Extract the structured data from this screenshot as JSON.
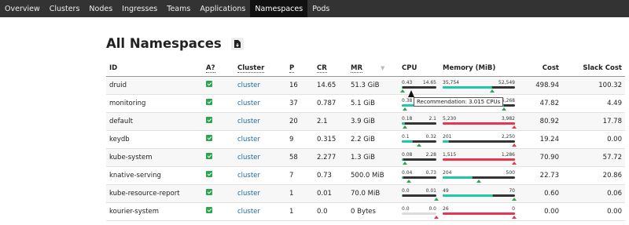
{
  "nav": [
    "Overview",
    "Clusters",
    "Nodes",
    "Ingresses",
    "Teams",
    "Applications",
    "Namespaces",
    "Pods"
  ],
  "nav_active": 6,
  "page_title": "All Namespaces",
  "export_icon": "file-download-icon",
  "columns": {
    "id": "ID",
    "a": "A?",
    "cluster": "Cluster",
    "p": "P",
    "cr": "CR",
    "mr": "MR",
    "cpu": "CPU",
    "memory": "Memory (MiB)",
    "cost": "Cost",
    "slack": "Slack Cost"
  },
  "colors": {
    "teal": "#20c9a6",
    "red": "#e8364f",
    "dark": "#333333",
    "light": "#dcdcdc",
    "green": "#2da44e"
  },
  "tooltip": "Recommendation: 3.015 CPUs",
  "rows": [
    {
      "id": "druid",
      "cluster": "cluster",
      "p": "16",
      "cr": "14.65",
      "mr": "51.3 GiB",
      "cpu_l": "0.43",
      "cpu_r": "14.65",
      "cpu_fill": 0.03,
      "cpu_fill_color": "#20c9a6",
      "cpu_track": "#333333",
      "cpu_tri": 0.03,
      "cpu_tri_red": false,
      "mem_l": "35,754",
      "mem_r": "52,549",
      "mem_fill": 0.68,
      "mem_fill_color": "#20c9a6",
      "mem_track": "#333333",
      "mem_tri": 0.68,
      "mem_tri_red": false,
      "cost": "498.94",
      "slack": "100.32"
    },
    {
      "id": "monitoring",
      "cluster": "cluster",
      "p": "37",
      "cr": "0.787",
      "mr": "5.1 GiB",
      "cpu_l": "0.38",
      "cpu_r": "",
      "cpu_fill": 0.45,
      "cpu_fill_color": "#20c9a6",
      "cpu_track": "#333333",
      "cpu_tri": 0.1,
      "cpu_tri_red": false,
      "mem_l": "",
      "mem_r": "5,268",
      "mem_fill": 0.85,
      "mem_fill_color": "#20c9a6",
      "mem_track": "#333333",
      "mem_tri": 0.85,
      "mem_tri_red": false,
      "cost": "47.82",
      "slack": "4.49"
    },
    {
      "id": "default",
      "cluster": "cluster",
      "p": "20",
      "cr": "2.1",
      "mr": "3.9 GiB",
      "cpu_l": "0.18",
      "cpu_r": "2.1",
      "cpu_fill": 0.09,
      "cpu_fill_color": "#20c9a6",
      "cpu_track": "#333333",
      "cpu_tri": 0.09,
      "cpu_tri_red": false,
      "mem_l": "5,230",
      "mem_r": "3,982",
      "mem_fill": 1.0,
      "mem_fill_color": "#e8364f",
      "mem_track": "#e8364f",
      "mem_tri": 0.99,
      "mem_tri_red": true,
      "cost": "80.92",
      "slack": "17.78"
    },
    {
      "id": "keydb",
      "cluster": "cluster",
      "p": "9",
      "cr": "0.315",
      "mr": "2.2 GiB",
      "cpu_l": "0.1",
      "cpu_r": "0.32",
      "cpu_fill": 0.32,
      "cpu_fill_color": "#20c9a6",
      "cpu_track": "#333333",
      "cpu_tri": 0.5,
      "cpu_tri_red": false,
      "mem_l": "201",
      "mem_r": "2,250",
      "mem_fill": 0.09,
      "mem_fill_color": "#20c9a6",
      "mem_track": "#333333",
      "mem_tri": 0.99,
      "mem_tri_red": true,
      "cost": "19.24",
      "slack": "0.00"
    },
    {
      "id": "kube-system",
      "cluster": "cluster",
      "p": "58",
      "cr": "2.277",
      "mr": "1.3 GiB",
      "cpu_l": "0.08",
      "cpu_r": "2.28",
      "cpu_fill": 0.04,
      "cpu_fill_color": "#20c9a6",
      "cpu_track": "#333333",
      "cpu_tri": 0.08,
      "cpu_tri_red": false,
      "mem_l": "1,515",
      "mem_r": "1,286",
      "mem_fill": 1.0,
      "mem_fill_color": "#e8364f",
      "mem_track": "#e8364f",
      "mem_tri": 0.99,
      "mem_tri_red": true,
      "cost": "70.90",
      "slack": "57.72"
    },
    {
      "id": "knative-serving",
      "cluster": "cluster",
      "p": "7",
      "cr": "0.73",
      "mr": "500.0 MiB",
      "cpu_l": "0.04",
      "cpu_r": "0.73",
      "cpu_fill": 0.05,
      "cpu_fill_color": "#20c9a6",
      "cpu_track": "#333333",
      "cpu_tri": 0.2,
      "cpu_tri_red": false,
      "mem_l": "204",
      "mem_r": "500",
      "mem_fill": 0.41,
      "mem_fill_color": "#20c9a6",
      "mem_track": "#333333",
      "mem_tri": 0.5,
      "mem_tri_red": false,
      "cost": "22.73",
      "slack": "20.86"
    },
    {
      "id": "kube-resource-report",
      "cluster": "cluster",
      "p": "1",
      "cr": "0.01",
      "mr": "70.0 MiB",
      "cpu_l": "0.0",
      "cpu_r": "0.01",
      "cpu_fill": 0.02,
      "cpu_fill_color": "#20c9a6",
      "cpu_track": "#333333",
      "cpu_tri": 0.99,
      "cpu_tri_red": false,
      "mem_l": "49",
      "mem_r": "70",
      "mem_fill": 0.7,
      "mem_fill_color": "#20c9a6",
      "mem_track": "#333333",
      "mem_tri": 0.99,
      "mem_tri_red": false,
      "cost": "0.60",
      "slack": "0.06"
    },
    {
      "id": "kourier-system",
      "cluster": "cluster",
      "p": "1",
      "cr": "0.0",
      "mr": "0 Bytes",
      "cpu_l": "0.0",
      "cpu_r": "0.0",
      "cpu_fill": 0.0,
      "cpu_fill_color": "#dcdcdc",
      "cpu_track": "#dcdcdc",
      "cpu_tri": 0.99,
      "cpu_tri_red": true,
      "mem_l": "26",
      "mem_r": "0",
      "mem_fill": 1.0,
      "mem_fill_color": "#e8364f",
      "mem_track": "#e8364f",
      "mem_tri": 0.99,
      "mem_tri_red": true,
      "cost": "0.00",
      "slack": "0.00"
    }
  ]
}
